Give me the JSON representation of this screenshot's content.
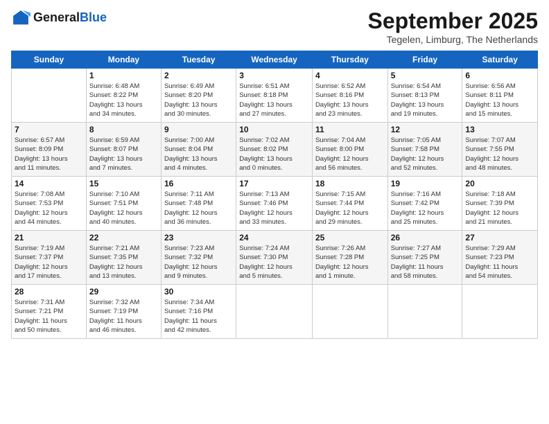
{
  "header": {
    "logo_general": "General",
    "logo_blue": "Blue",
    "month_title": "September 2025",
    "location": "Tegelen, Limburg, The Netherlands"
  },
  "weekdays": [
    "Sunday",
    "Monday",
    "Tuesday",
    "Wednesday",
    "Thursday",
    "Friday",
    "Saturday"
  ],
  "weeks": [
    [
      {
        "day": "",
        "info": ""
      },
      {
        "day": "1",
        "info": "Sunrise: 6:48 AM\nSunset: 8:22 PM\nDaylight: 13 hours\nand 34 minutes."
      },
      {
        "day": "2",
        "info": "Sunrise: 6:49 AM\nSunset: 8:20 PM\nDaylight: 13 hours\nand 30 minutes."
      },
      {
        "day": "3",
        "info": "Sunrise: 6:51 AM\nSunset: 8:18 PM\nDaylight: 13 hours\nand 27 minutes."
      },
      {
        "day": "4",
        "info": "Sunrise: 6:52 AM\nSunset: 8:16 PM\nDaylight: 13 hours\nand 23 minutes."
      },
      {
        "day": "5",
        "info": "Sunrise: 6:54 AM\nSunset: 8:13 PM\nDaylight: 13 hours\nand 19 minutes."
      },
      {
        "day": "6",
        "info": "Sunrise: 6:56 AM\nSunset: 8:11 PM\nDaylight: 13 hours\nand 15 minutes."
      }
    ],
    [
      {
        "day": "7",
        "info": "Sunrise: 6:57 AM\nSunset: 8:09 PM\nDaylight: 13 hours\nand 11 minutes."
      },
      {
        "day": "8",
        "info": "Sunrise: 6:59 AM\nSunset: 8:07 PM\nDaylight: 13 hours\nand 7 minutes."
      },
      {
        "day": "9",
        "info": "Sunrise: 7:00 AM\nSunset: 8:04 PM\nDaylight: 13 hours\nand 4 minutes."
      },
      {
        "day": "10",
        "info": "Sunrise: 7:02 AM\nSunset: 8:02 PM\nDaylight: 13 hours\nand 0 minutes."
      },
      {
        "day": "11",
        "info": "Sunrise: 7:04 AM\nSunset: 8:00 PM\nDaylight: 12 hours\nand 56 minutes."
      },
      {
        "day": "12",
        "info": "Sunrise: 7:05 AM\nSunset: 7:58 PM\nDaylight: 12 hours\nand 52 minutes."
      },
      {
        "day": "13",
        "info": "Sunrise: 7:07 AM\nSunset: 7:55 PM\nDaylight: 12 hours\nand 48 minutes."
      }
    ],
    [
      {
        "day": "14",
        "info": "Sunrise: 7:08 AM\nSunset: 7:53 PM\nDaylight: 12 hours\nand 44 minutes."
      },
      {
        "day": "15",
        "info": "Sunrise: 7:10 AM\nSunset: 7:51 PM\nDaylight: 12 hours\nand 40 minutes."
      },
      {
        "day": "16",
        "info": "Sunrise: 7:11 AM\nSunset: 7:48 PM\nDaylight: 12 hours\nand 36 minutes."
      },
      {
        "day": "17",
        "info": "Sunrise: 7:13 AM\nSunset: 7:46 PM\nDaylight: 12 hours\nand 33 minutes."
      },
      {
        "day": "18",
        "info": "Sunrise: 7:15 AM\nSunset: 7:44 PM\nDaylight: 12 hours\nand 29 minutes."
      },
      {
        "day": "19",
        "info": "Sunrise: 7:16 AM\nSunset: 7:42 PM\nDaylight: 12 hours\nand 25 minutes."
      },
      {
        "day": "20",
        "info": "Sunrise: 7:18 AM\nSunset: 7:39 PM\nDaylight: 12 hours\nand 21 minutes."
      }
    ],
    [
      {
        "day": "21",
        "info": "Sunrise: 7:19 AM\nSunset: 7:37 PM\nDaylight: 12 hours\nand 17 minutes."
      },
      {
        "day": "22",
        "info": "Sunrise: 7:21 AM\nSunset: 7:35 PM\nDaylight: 12 hours\nand 13 minutes."
      },
      {
        "day": "23",
        "info": "Sunrise: 7:23 AM\nSunset: 7:32 PM\nDaylight: 12 hours\nand 9 minutes."
      },
      {
        "day": "24",
        "info": "Sunrise: 7:24 AM\nSunset: 7:30 PM\nDaylight: 12 hours\nand 5 minutes."
      },
      {
        "day": "25",
        "info": "Sunrise: 7:26 AM\nSunset: 7:28 PM\nDaylight: 12 hours\nand 1 minute."
      },
      {
        "day": "26",
        "info": "Sunrise: 7:27 AM\nSunset: 7:25 PM\nDaylight: 11 hours\nand 58 minutes."
      },
      {
        "day": "27",
        "info": "Sunrise: 7:29 AM\nSunset: 7:23 PM\nDaylight: 11 hours\nand 54 minutes."
      }
    ],
    [
      {
        "day": "28",
        "info": "Sunrise: 7:31 AM\nSunset: 7:21 PM\nDaylight: 11 hours\nand 50 minutes."
      },
      {
        "day": "29",
        "info": "Sunrise: 7:32 AM\nSunset: 7:19 PM\nDaylight: 11 hours\nand 46 minutes."
      },
      {
        "day": "30",
        "info": "Sunrise: 7:34 AM\nSunset: 7:16 PM\nDaylight: 11 hours\nand 42 minutes."
      },
      {
        "day": "",
        "info": ""
      },
      {
        "day": "",
        "info": ""
      },
      {
        "day": "",
        "info": ""
      },
      {
        "day": "",
        "info": ""
      }
    ]
  ]
}
